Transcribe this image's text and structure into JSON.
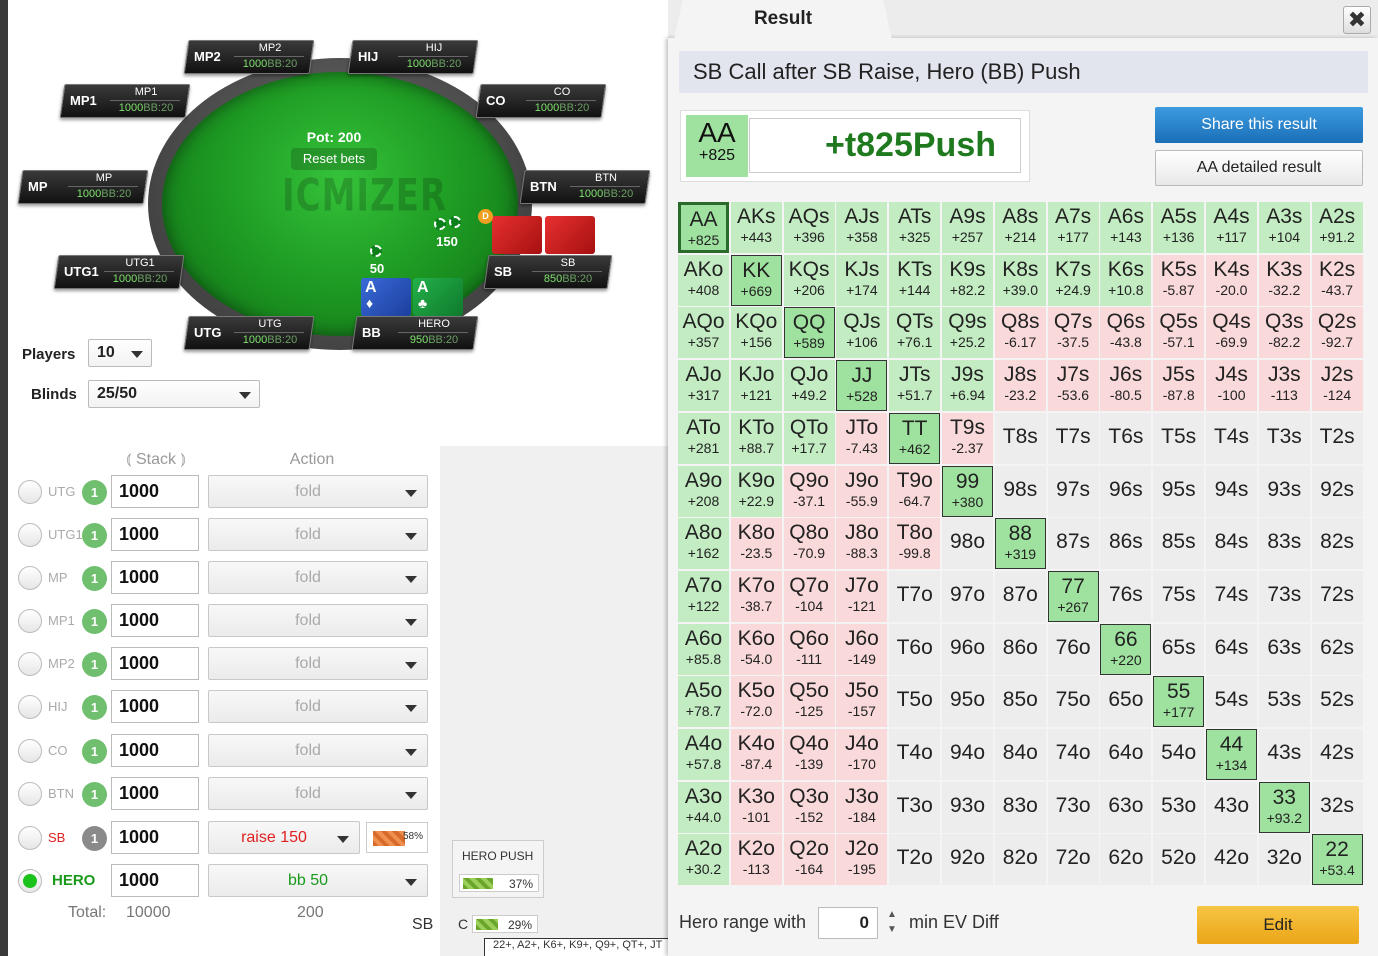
{
  "table": {
    "pot_label": "Pot: 200",
    "reset_label": "Reset bets",
    "watermark": "ICMIZER",
    "dealer": "D",
    "sb_bet": "150",
    "bb_bet": "50",
    "seats": [
      {
        "tag": "MP2",
        "name": "MP2",
        "stack": "1000",
        "bb": "BB:20"
      },
      {
        "tag": "HIJ",
        "name": "HIJ",
        "stack": "1000",
        "bb": "BB:20"
      },
      {
        "tag": "MP1",
        "name": "MP1",
        "stack": "1000",
        "bb": "BB:20"
      },
      {
        "tag": "CO",
        "name": "CO",
        "stack": "1000",
        "bb": "BB:20"
      },
      {
        "tag": "MP",
        "name": "MP",
        "stack": "1000",
        "bb": "BB:20"
      },
      {
        "tag": "BTN",
        "name": "BTN",
        "stack": "1000",
        "bb": "BB:20"
      },
      {
        "tag": "UTG1",
        "name": "UTG1",
        "stack": "1000",
        "bb": "BB:20"
      },
      {
        "tag": "SB",
        "name": "SB",
        "stack": "850",
        "bb": "BB:20"
      },
      {
        "tag": "UTG",
        "name": "UTG",
        "stack": "1000",
        "bb": "BB:20"
      },
      {
        "tag": "BB",
        "name": "HERO",
        "stack": "950",
        "bb": "BB:20"
      }
    ],
    "hero_cards": [
      {
        "rank": "A",
        "suit": "♦"
      },
      {
        "rank": "A",
        "suit": "♣"
      }
    ]
  },
  "settings": {
    "players_label": "Players",
    "players_value": "10",
    "blinds_label": "Blinds",
    "blinds_value": "25/50"
  },
  "grid_headers": {
    "stack": "Stack",
    "action": "Action"
  },
  "players": [
    {
      "name": "UTG",
      "badge": "1",
      "stack": "1000",
      "action": "fold"
    },
    {
      "name": "UTG1",
      "badge": "1",
      "stack": "1000",
      "action": "fold"
    },
    {
      "name": "MP",
      "badge": "1",
      "stack": "1000",
      "action": "fold"
    },
    {
      "name": "MP1",
      "badge": "1",
      "stack": "1000",
      "action": "fold"
    },
    {
      "name": "MP2",
      "badge": "1",
      "stack": "1000",
      "action": "fold"
    },
    {
      "name": "HIJ",
      "badge": "1",
      "stack": "1000",
      "action": "fold"
    },
    {
      "name": "CO",
      "badge": "1",
      "stack": "1000",
      "action": "fold"
    },
    {
      "name": "BTN",
      "badge": "1",
      "stack": "1000",
      "action": "fold"
    },
    {
      "name": "SB",
      "badge": "1",
      "stack": "1000",
      "action": "raise 150",
      "pct": "58%"
    },
    {
      "name": "HERO",
      "badge": "",
      "stack": "1000",
      "action": "bb 50"
    }
  ],
  "totals": {
    "label": "Total:",
    "stack": "10000",
    "action": "200"
  },
  "hero_push": {
    "title": "HERO PUSH",
    "pct": "37%",
    "c_label": "C",
    "c_pct": "29%",
    "sb_label": "SB"
  },
  "range_strip": "22+, A2+, K6+, K9+, Q9+, QT+, JT",
  "result": {
    "tab": "Result",
    "close": "✖",
    "title": "SB Call after SB Raise, Hero (BB) Push",
    "hand": "AA",
    "hand_ev": "+825",
    "big": "+t825Push",
    "share": "Share this result",
    "detail": "AA detailed result",
    "range_label": "Hero range with",
    "ev_value": "0",
    "ev_label": "min EV Diff",
    "edit": "Edit"
  },
  "matrix": [
    [
      [
        "AA",
        "+825"
      ],
      [
        "AKs",
        "+443"
      ],
      [
        "AQs",
        "+396"
      ],
      [
        "AJs",
        "+358"
      ],
      [
        "ATs",
        "+325"
      ],
      [
        "A9s",
        "+257"
      ],
      [
        "A8s",
        "+214"
      ],
      [
        "A7s",
        "+177"
      ],
      [
        "A6s",
        "+143"
      ],
      [
        "A5s",
        "+136"
      ],
      [
        "A4s",
        "+117"
      ],
      [
        "A3s",
        "+104"
      ],
      [
        "A2s",
        "+91.2"
      ]
    ],
    [
      [
        "AKo",
        "+408"
      ],
      [
        "KK",
        "+669"
      ],
      [
        "KQs",
        "+206"
      ],
      [
        "KJs",
        "+174"
      ],
      [
        "KTs",
        "+144"
      ],
      [
        "K9s",
        "+82.2"
      ],
      [
        "K8s",
        "+39.0"
      ],
      [
        "K7s",
        "+24.9"
      ],
      [
        "K6s",
        "+10.8"
      ],
      [
        "K5s",
        "-5.87"
      ],
      [
        "K4s",
        "-20.0"
      ],
      [
        "K3s",
        "-32.2"
      ],
      [
        "K2s",
        "-43.7"
      ]
    ],
    [
      [
        "AQo",
        "+357"
      ],
      [
        "KQo",
        "+156"
      ],
      [
        "QQ",
        "+589"
      ],
      [
        "QJs",
        "+106"
      ],
      [
        "QTs",
        "+76.1"
      ],
      [
        "Q9s",
        "+25.2"
      ],
      [
        "Q8s",
        "-6.17"
      ],
      [
        "Q7s",
        "-37.5"
      ],
      [
        "Q6s",
        "-43.8"
      ],
      [
        "Q5s",
        "-57.1"
      ],
      [
        "Q4s",
        "-69.9"
      ],
      [
        "Q3s",
        "-82.2"
      ],
      [
        "Q2s",
        "-92.7"
      ]
    ],
    [
      [
        "AJo",
        "+317"
      ],
      [
        "KJo",
        "+121"
      ],
      [
        "QJo",
        "+49.2"
      ],
      [
        "JJ",
        "+528"
      ],
      [
        "JTs",
        "+51.7"
      ],
      [
        "J9s",
        "+6.94"
      ],
      [
        "J8s",
        "-23.2"
      ],
      [
        "J7s",
        "-53.6"
      ],
      [
        "J6s",
        "-80.5"
      ],
      [
        "J5s",
        "-87.8"
      ],
      [
        "J4s",
        "-100"
      ],
      [
        "J3s",
        "-113"
      ],
      [
        "J2s",
        "-124"
      ]
    ],
    [
      [
        "ATo",
        "+281"
      ],
      [
        "KTo",
        "+88.7"
      ],
      [
        "QTo",
        "+17.7"
      ],
      [
        "JTo",
        "-7.43"
      ],
      [
        "TT",
        "+462"
      ],
      [
        "T9s",
        "-2.37"
      ],
      [
        "T8s",
        ""
      ],
      [
        "T7s",
        ""
      ],
      [
        "T6s",
        ""
      ],
      [
        "T5s",
        ""
      ],
      [
        "T4s",
        ""
      ],
      [
        "T3s",
        ""
      ],
      [
        "T2s",
        ""
      ]
    ],
    [
      [
        "A9o",
        "+208"
      ],
      [
        "K9o",
        "+22.9"
      ],
      [
        "Q9o",
        "-37.1"
      ],
      [
        "J9o",
        "-55.9"
      ],
      [
        "T9o",
        "-64.7"
      ],
      [
        "99",
        "+380"
      ],
      [
        "98s",
        ""
      ],
      [
        "97s",
        ""
      ],
      [
        "96s",
        ""
      ],
      [
        "95s",
        ""
      ],
      [
        "94s",
        ""
      ],
      [
        "93s",
        ""
      ],
      [
        "92s",
        ""
      ]
    ],
    [
      [
        "A8o",
        "+162"
      ],
      [
        "K8o",
        "-23.5"
      ],
      [
        "Q8o",
        "-70.9"
      ],
      [
        "J8o",
        "-88.3"
      ],
      [
        "T8o",
        "-99.8"
      ],
      [
        "98o",
        ""
      ],
      [
        "88",
        "+319"
      ],
      [
        "87s",
        ""
      ],
      [
        "86s",
        ""
      ],
      [
        "85s",
        ""
      ],
      [
        "84s",
        ""
      ],
      [
        "83s",
        ""
      ],
      [
        "82s",
        ""
      ]
    ],
    [
      [
        "A7o",
        "+122"
      ],
      [
        "K7o",
        "-38.7"
      ],
      [
        "Q7o",
        "-104"
      ],
      [
        "J7o",
        "-121"
      ],
      [
        "T7o",
        ""
      ],
      [
        "97o",
        ""
      ],
      [
        "87o",
        ""
      ],
      [
        "77",
        "+267"
      ],
      [
        "76s",
        ""
      ],
      [
        "75s",
        ""
      ],
      [
        "74s",
        ""
      ],
      [
        "73s",
        ""
      ],
      [
        "72s",
        ""
      ]
    ],
    [
      [
        "A6o",
        "+85.8"
      ],
      [
        "K6o",
        "-54.0"
      ],
      [
        "Q6o",
        "-111"
      ],
      [
        "J6o",
        "-149"
      ],
      [
        "T6o",
        ""
      ],
      [
        "96o",
        ""
      ],
      [
        "86o",
        ""
      ],
      [
        "76o",
        ""
      ],
      [
        "66",
        "+220"
      ],
      [
        "65s",
        ""
      ],
      [
        "64s",
        ""
      ],
      [
        "63s",
        ""
      ],
      [
        "62s",
        ""
      ]
    ],
    [
      [
        "A5o",
        "+78.7"
      ],
      [
        "K5o",
        "-72.0"
      ],
      [
        "Q5o",
        "-125"
      ],
      [
        "J5o",
        "-157"
      ],
      [
        "T5o",
        ""
      ],
      [
        "95o",
        ""
      ],
      [
        "85o",
        ""
      ],
      [
        "75o",
        ""
      ],
      [
        "65o",
        ""
      ],
      [
        "55",
        "+177"
      ],
      [
        "54s",
        ""
      ],
      [
        "53s",
        ""
      ],
      [
        "52s",
        ""
      ]
    ],
    [
      [
        "A4o",
        "+57.8"
      ],
      [
        "K4o",
        "-87.4"
      ],
      [
        "Q4o",
        "-139"
      ],
      [
        "J4o",
        "-170"
      ],
      [
        "T4o",
        ""
      ],
      [
        "94o",
        ""
      ],
      [
        "84o",
        ""
      ],
      [
        "74o",
        ""
      ],
      [
        "64o",
        ""
      ],
      [
        "54o",
        ""
      ],
      [
        "44",
        "+134"
      ],
      [
        "43s",
        ""
      ],
      [
        "42s",
        ""
      ]
    ],
    [
      [
        "A3o",
        "+44.0"
      ],
      [
        "K3o",
        "-101"
      ],
      [
        "Q3o",
        "-152"
      ],
      [
        "J3o",
        "-184"
      ],
      [
        "T3o",
        ""
      ],
      [
        "93o",
        ""
      ],
      [
        "83o",
        ""
      ],
      [
        "73o",
        ""
      ],
      [
        "63o",
        ""
      ],
      [
        "53o",
        ""
      ],
      [
        "43o",
        ""
      ],
      [
        "33",
        "+93.2"
      ],
      [
        "32s",
        ""
      ]
    ],
    [
      [
        "A2o",
        "+30.2"
      ],
      [
        "K2o",
        "-113"
      ],
      [
        "Q2o",
        "-164"
      ],
      [
        "J2o",
        "-195"
      ],
      [
        "T2o",
        ""
      ],
      [
        "92o",
        ""
      ],
      [
        "82o",
        ""
      ],
      [
        "72o",
        ""
      ],
      [
        "62o",
        ""
      ],
      [
        "52o",
        ""
      ],
      [
        "42o",
        ""
      ],
      [
        "32o",
        ""
      ],
      [
        "22",
        "+53.4"
      ]
    ]
  ],
  "colors": {
    "push": "#c3ecc3",
    "pair": "#9fe29f",
    "negative": "#f9d9d9",
    "none": "#ededed",
    "hero_green": "#1a9a1a",
    "sb_red": "#e02020"
  }
}
